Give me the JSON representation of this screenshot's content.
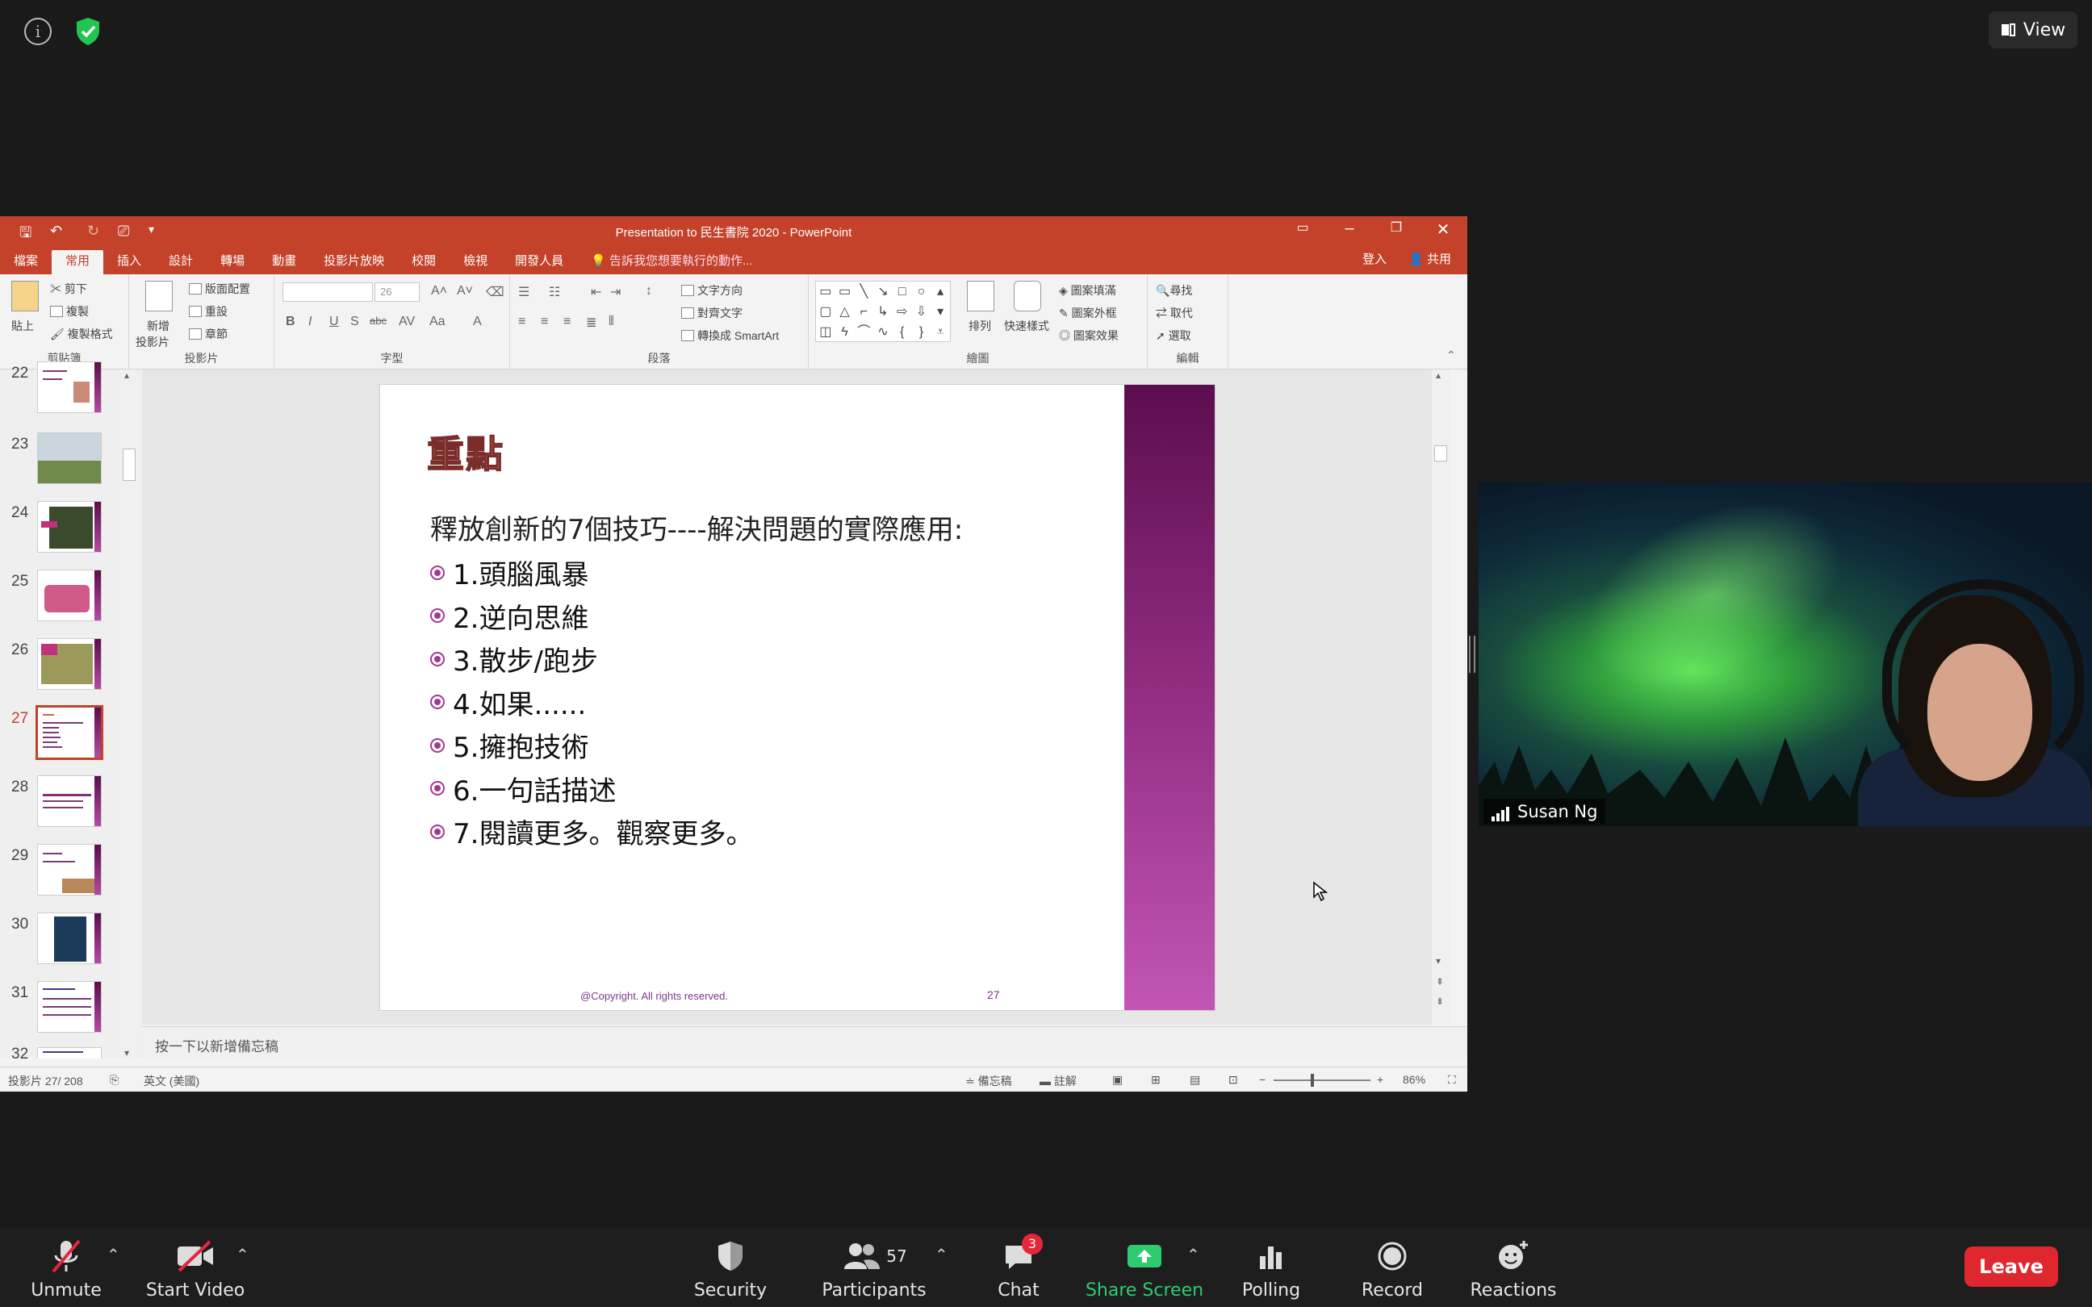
{
  "zoom": {
    "view_label": "View",
    "info_icon_glyph": "i",
    "toolbar": {
      "unmute": "Unmute",
      "start_video": "Start Video",
      "security": "Security",
      "participants": "Participants",
      "participants_count": "57",
      "chat": "Chat",
      "chat_badge": "3",
      "share_screen": "Share Screen",
      "polling": "Polling",
      "record": "Record",
      "reactions": "Reactions",
      "leave": "Leave"
    },
    "video": {
      "participant_name": "Susan Ng"
    },
    "colors": {
      "share_green": "#2ecc71",
      "leave_red": "#e0262f",
      "badge_red": "#e5263b"
    }
  },
  "powerpoint": {
    "window_title": "Presentation to 民生書院 2020 - PowerPoint",
    "tabs": [
      "檔案",
      "常用",
      "插入",
      "設計",
      "轉場",
      "動畫",
      "投影片放映",
      "校閱",
      "檢視",
      "開發人員"
    ],
    "active_tab": "常用",
    "tell_me": "告訴我您想要執行的動作...",
    "login": "登入",
    "share": "共用",
    "ribbon": {
      "clipboard": {
        "paste": "貼上",
        "cut": "剪下",
        "copy": "複製",
        "format_painter": "複製格式",
        "label": "剪貼簿"
      },
      "slides": {
        "new_slide": "新增",
        "new_slide_2": "投影片",
        "layout": "版面配置",
        "reset": "重設",
        "section": "章節",
        "label": "投影片"
      },
      "font": {
        "size": "26",
        "label": "字型"
      },
      "paragraph": {
        "text_direction": "文字方向",
        "align_text": "對齊文字",
        "smartart": "轉換成 SmartArt",
        "label": "段落"
      },
      "drawing": {
        "arrange": "排列",
        "quick_styles": "快速樣式",
        "shape_fill": "圖案填滿",
        "shape_outline": "圖案外框",
        "shape_effects": "圖案效果",
        "label": "繪圖"
      },
      "editing": {
        "find": "尋找",
        "replace": "取代",
        "select": "選取",
        "label": "編輯"
      }
    },
    "thumbnails": [
      "22",
      "23",
      "24",
      "25",
      "26",
      "27",
      "28",
      "29",
      "30",
      "31",
      "32"
    ],
    "active_thumbnail": "27",
    "slide": {
      "title": "重點",
      "subtitle": "釋放創新的7個技巧----解決問題的實際應用:",
      "items": [
        "1.頭腦風暴",
        "2.逆向思維",
        "3.散步/跑步",
        "4.如果......",
        "5.擁抱技術",
        "6.一句話描述",
        "7.閱讀更多。觀察更多。"
      ],
      "copyright": "@Copyright. All rights reserved.",
      "number": "27"
    },
    "notes_placeholder": "按一下以新增備忘稿",
    "status": {
      "slide_counter": "投影片 27/ 208",
      "language": "英文 (美國)",
      "notes": "備忘稿",
      "comments": "註解",
      "zoom_level": "86%"
    },
    "colors": {
      "titlebar": "#c4412a",
      "slide_bar_top": "#5c0d4f",
      "slide_bar_bottom": "#c255b5",
      "bullet": "#a2398f"
    }
  }
}
